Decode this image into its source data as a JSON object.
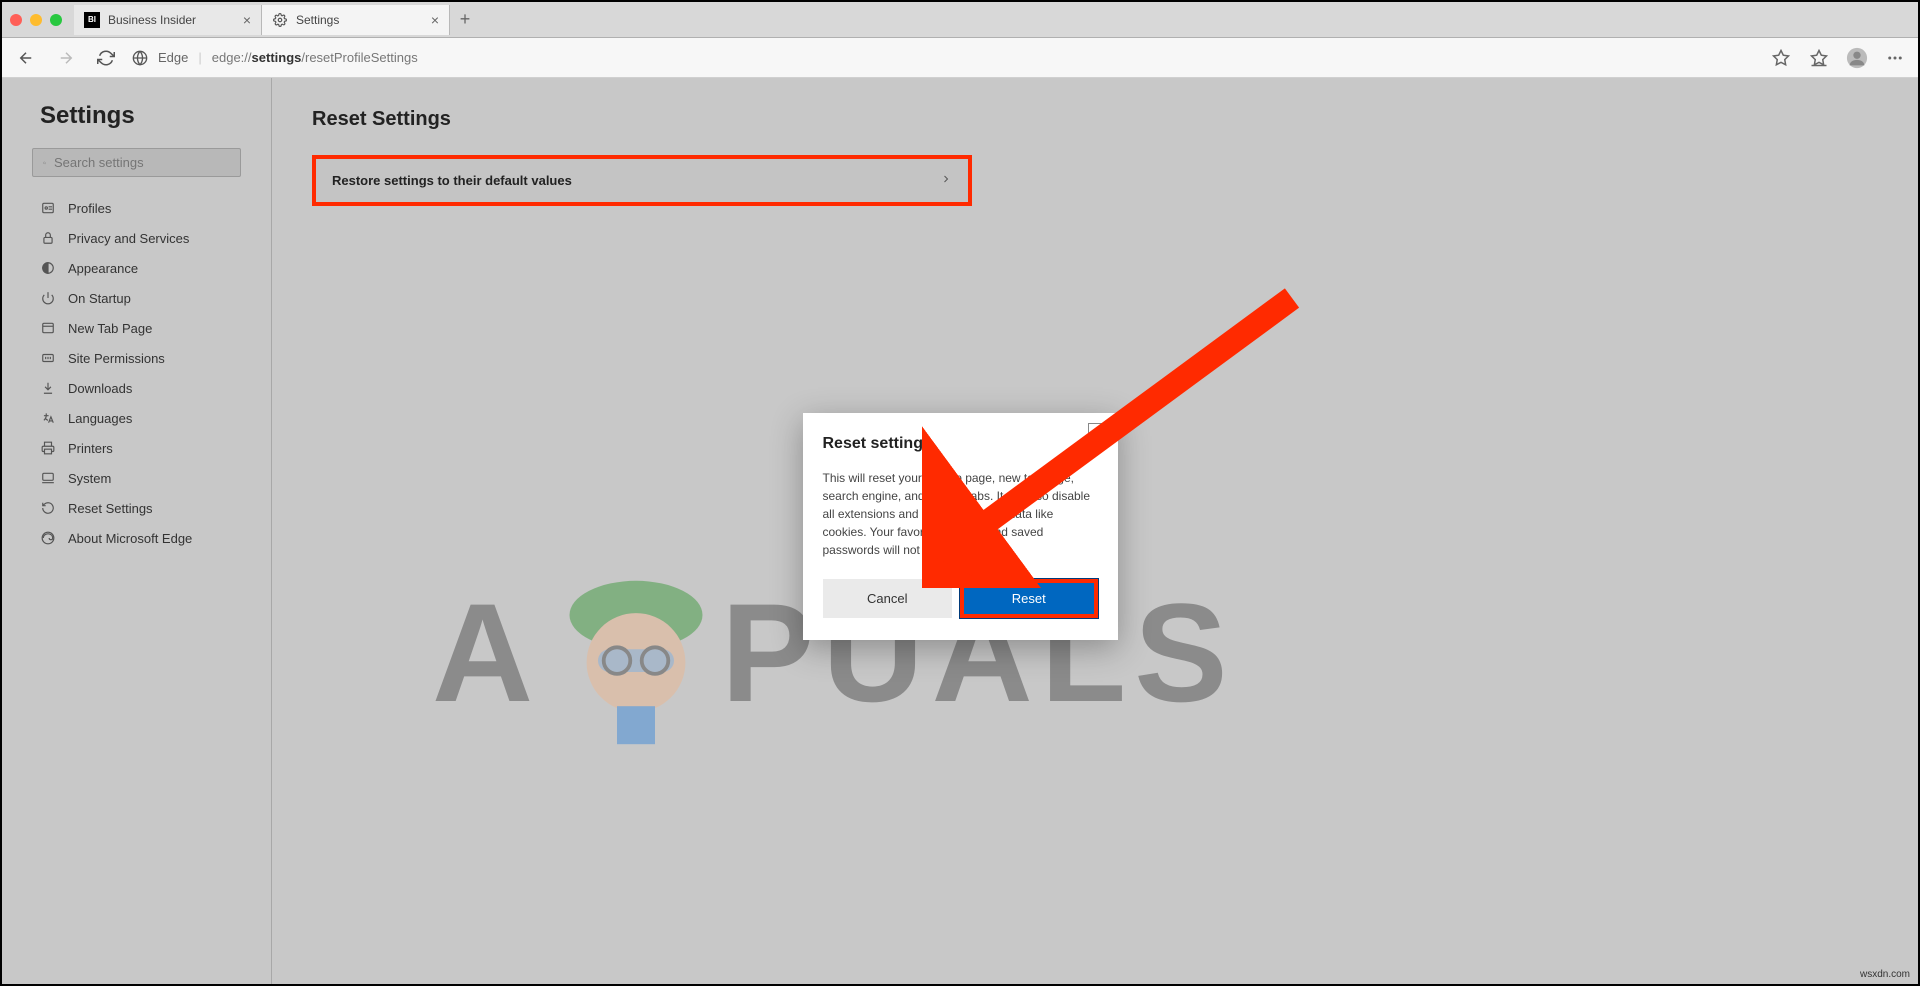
{
  "tabs": [
    {
      "title": "Business Insider",
      "favicon": "BI"
    },
    {
      "title": "Settings",
      "favicon": "gear"
    }
  ],
  "address": {
    "app": "Edge",
    "prefix": "edge://",
    "bold": "settings",
    "suffix": "/resetProfileSettings"
  },
  "sidebar": {
    "title": "Settings",
    "search_placeholder": "Search settings",
    "items": [
      {
        "label": "Profiles",
        "icon": "profile"
      },
      {
        "label": "Privacy and Services",
        "icon": "lock"
      },
      {
        "label": "Appearance",
        "icon": "appearance"
      },
      {
        "label": "On Startup",
        "icon": "power"
      },
      {
        "label": "New Tab Page",
        "icon": "newtab"
      },
      {
        "label": "Site Permissions",
        "icon": "permissions"
      },
      {
        "label": "Downloads",
        "icon": "download"
      },
      {
        "label": "Languages",
        "icon": "language"
      },
      {
        "label": "Printers",
        "icon": "printer"
      },
      {
        "label": "System",
        "icon": "system"
      },
      {
        "label": "Reset Settings",
        "icon": "reset"
      },
      {
        "label": "About Microsoft Edge",
        "icon": "edge"
      }
    ]
  },
  "main": {
    "title": "Reset Settings",
    "restore_label": "Restore settings to their default values"
  },
  "modal": {
    "title": "Reset settings",
    "text": "This will reset your startup page, new tab page, search engine, and pinned tabs. It will also disable all extensions and clear temporary data like cookies. Your favorites, history and saved passwords will not be cleared.",
    "cancel": "Cancel",
    "reset": "Reset"
  },
  "watermark": {
    "pre": "A",
    "post": "PUALS",
    "credit": "wsxdn.com"
  }
}
